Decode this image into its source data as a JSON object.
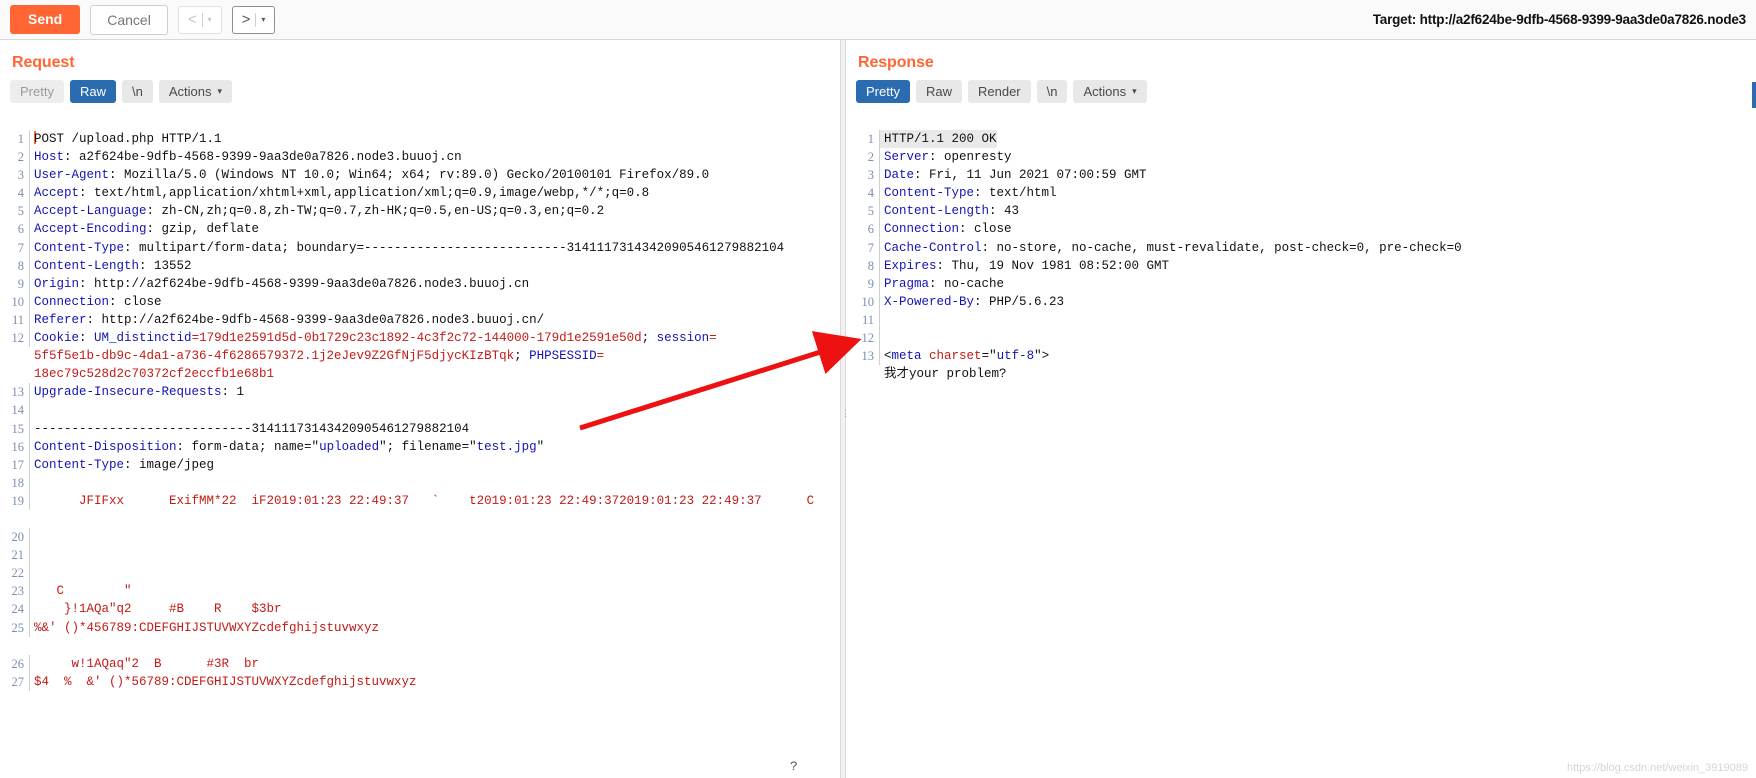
{
  "toolbar": {
    "send_label": "Send",
    "cancel_label": "Cancel",
    "prev_arrow": "<",
    "next_arrow": ">",
    "caret": "▾",
    "target_label": "Target: http://a2f624be-9dfb-4568-9399-9aa3de0a7826.node3"
  },
  "request": {
    "title": "Request",
    "tabs": [
      {
        "label": "Pretty",
        "selected": false,
        "muted": true
      },
      {
        "label": "Raw",
        "selected": true,
        "muted": false
      },
      {
        "label": "\\n",
        "selected": false,
        "muted": false
      }
    ],
    "actions_label": "Actions",
    "actions_caret": "⌄",
    "lines": [
      {
        "n": "1",
        "segments": [
          {
            "t": "POST /upload.php HTTP/1.1",
            "c": "v"
          }
        ],
        "caret": true
      },
      {
        "n": "2",
        "segments": [
          {
            "t": "Host",
            "c": "k"
          },
          {
            "t": ": a2f624be-9dfb-4568-9399-9aa3de0a7826.node3.buuoj.cn",
            "c": "v"
          }
        ]
      },
      {
        "n": "3",
        "segments": [
          {
            "t": "User-Agent",
            "c": "k"
          },
          {
            "t": ": Mozilla/5.0 (Windows NT 10.0; Win64; x64; rv:89.0) Gecko/20100101 Firefox/89.0",
            "c": "v"
          }
        ]
      },
      {
        "n": "4",
        "segments": [
          {
            "t": "Accept",
            "c": "k"
          },
          {
            "t": ": text/html,application/xhtml+xml,application/xml;q=0.9,image/webp,*/*;q=0.8",
            "c": "v"
          }
        ]
      },
      {
        "n": "5",
        "segments": [
          {
            "t": "Accept-Language",
            "c": "k"
          },
          {
            "t": ": zh-CN,zh;q=0.8,zh-TW;q=0.7,zh-HK;q=0.5,en-US;q=0.3,en;q=0.2",
            "c": "v"
          }
        ]
      },
      {
        "n": "6",
        "segments": [
          {
            "t": "Accept-Encoding",
            "c": "k"
          },
          {
            "t": ": gzip, deflate",
            "c": "v"
          }
        ]
      },
      {
        "n": "7",
        "segments": [
          {
            "t": "Content-Type",
            "c": "k"
          },
          {
            "t": ": multipart/form-data; boundary=---------------------------31411173143420905461279882104",
            "c": "v"
          }
        ]
      },
      {
        "n": "8",
        "segments": [
          {
            "t": "Content-Length",
            "c": "k"
          },
          {
            "t": ": 13552",
            "c": "v"
          }
        ]
      },
      {
        "n": "9",
        "segments": [
          {
            "t": "Origin",
            "c": "k"
          },
          {
            "t": ": http://a2f624be-9dfb-4568-9399-9aa3de0a7826.node3.buuoj.cn",
            "c": "v"
          }
        ]
      },
      {
        "n": "10",
        "segments": [
          {
            "t": "Connection",
            "c": "k"
          },
          {
            "t": ": close",
            "c": "v"
          }
        ]
      },
      {
        "n": "11",
        "segments": [
          {
            "t": "Referer",
            "c": "k"
          },
          {
            "t": ": http://a2f624be-9dfb-4568-9399-9aa3de0a7826.node3.buuoj.cn/",
            "c": "v"
          }
        ]
      },
      {
        "n": "12",
        "segments": [
          {
            "t": "Cookie",
            "c": "k"
          },
          {
            "t": ": ",
            "c": "v"
          },
          {
            "t": "UM_distinctid",
            "c": "ck"
          },
          {
            "t": "=179d1e2591d5d-0b1729c23c1892-4c3f2c72-144000-179d1e2591e50d",
            "c": "cv"
          },
          {
            "t": "; ",
            "c": "v"
          },
          {
            "t": "session",
            "c": "ck"
          },
          {
            "t": "=",
            "c": "cv"
          }
        ]
      },
      {
        "n": "",
        "segments": [
          {
            "t": "5f5f5e1b-db9c-4da1-a736-4f6286579372.1j2eJev9Z2GfNjF5djycKIzBTqk",
            "c": "cv"
          },
          {
            "t": "; ",
            "c": "v"
          },
          {
            "t": "PHPSESSID",
            "c": "ck"
          },
          {
            "t": "=",
            "c": "cv"
          }
        ]
      },
      {
        "n": "",
        "segments": [
          {
            "t": "18ec79c528d2c70372cf2eccfb1e68b1",
            "c": "cv"
          }
        ]
      },
      {
        "n": "13",
        "segments": [
          {
            "t": "Upgrade-Insecure-Requests",
            "c": "k"
          },
          {
            "t": ": 1",
            "c": "v"
          }
        ]
      },
      {
        "n": "14",
        "segments": []
      },
      {
        "n": "15",
        "segments": [
          {
            "t": "-----------------------------31411173143420905461279882104",
            "c": "v"
          }
        ]
      },
      {
        "n": "16",
        "segments": [
          {
            "t": "Content-Disposition",
            "c": "k"
          },
          {
            "t": ": form-data; name=\"",
            "c": "v"
          },
          {
            "t": "uploaded",
            "c": "at"
          },
          {
            "t": "\"; filename=\"",
            "c": "v"
          },
          {
            "t": "test.jpg",
            "c": "at"
          },
          {
            "t": "\"",
            "c": "v"
          }
        ]
      },
      {
        "n": "17",
        "segments": [
          {
            "t": "Content-Type",
            "c": "k"
          },
          {
            "t": ": image/jpeg",
            "c": "v"
          }
        ]
      },
      {
        "n": "18",
        "segments": []
      },
      {
        "n": "19",
        "segments": [
          {
            "t": "      JFIFxx      ExifMM*22  iF2019:01:23 22:49:37   `    t2019:01:23 22:49:372019:01:23 22:49:37      C",
            "c": "bin"
          }
        ]
      },
      {
        "n": "",
        "segments": []
      },
      {
        "n": "20",
        "segments": []
      },
      {
        "n": "21",
        "segments": []
      },
      {
        "n": "22",
        "segments": []
      },
      {
        "n": "23",
        "segments": [
          {
            "t": "   C        ʺ",
            "c": "bin"
          }
        ]
      },
      {
        "n": "24",
        "segments": [
          {
            "t": "    }!1AQaʺq2     #B    R    $3br",
            "c": "bin"
          }
        ]
      },
      {
        "n": "25",
        "segments": [
          {
            "t": "%&' ()*456789:CDEFGHIJSTUVWXYZcdefghijstuvwxyz",
            "c": "bin"
          }
        ]
      },
      {
        "n": "",
        "segments": []
      },
      {
        "n": "26",
        "segments": [
          {
            "t": "     w!1AQaqʺ2  B      #3R  br",
            "c": "bin"
          }
        ]
      },
      {
        "n": "27",
        "segments": [
          {
            "t": "$4  %  &' ()*56789:CDEFGHIJSTUVWXYZcdefghijstuvwxyz",
            "c": "bin"
          }
        ]
      }
    ],
    "bottom_marker": "?"
  },
  "response": {
    "title": "Response",
    "tabs": [
      {
        "label": "Pretty",
        "selected": true,
        "muted": false
      },
      {
        "label": "Raw",
        "selected": false,
        "muted": false
      },
      {
        "label": "Render",
        "selected": false,
        "muted": false
      },
      {
        "label": "\\n",
        "selected": false,
        "muted": false
      }
    ],
    "actions_label": "Actions",
    "actions_caret": "⌄",
    "lines": [
      {
        "n": "1",
        "hl": true,
        "segments": [
          {
            "t": "HTTP/1.1 200 OK",
            "c": "v"
          }
        ]
      },
      {
        "n": "2",
        "segments": [
          {
            "t": "Server",
            "c": "k"
          },
          {
            "t": ": openresty",
            "c": "v"
          }
        ]
      },
      {
        "n": "3",
        "segments": [
          {
            "t": "Date",
            "c": "k"
          },
          {
            "t": ": Fri, 11 Jun 2021 07:00:59 GMT",
            "c": "v"
          }
        ]
      },
      {
        "n": "4",
        "segments": [
          {
            "t": "Content-Type",
            "c": "k"
          },
          {
            "t": ": text/html",
            "c": "v"
          }
        ]
      },
      {
        "n": "5",
        "segments": [
          {
            "t": "Content-Length",
            "c": "k"
          },
          {
            "t": ": 43",
            "c": "v"
          }
        ]
      },
      {
        "n": "6",
        "segments": [
          {
            "t": "Connection",
            "c": "k"
          },
          {
            "t": ": close",
            "c": "v"
          }
        ]
      },
      {
        "n": "7",
        "segments": [
          {
            "t": "Cache-Control",
            "c": "k"
          },
          {
            "t": ": no-store, no-cache, must-revalidate, post-check=0, pre-check=0",
            "c": "v"
          }
        ]
      },
      {
        "n": "8",
        "segments": [
          {
            "t": "Expires",
            "c": "k"
          },
          {
            "t": ": Thu, 19 Nov 1981 08:52:00 GMT",
            "c": "v"
          }
        ]
      },
      {
        "n": "9",
        "segments": [
          {
            "t": "Pragma",
            "c": "k"
          },
          {
            "t": ": no-cache",
            "c": "v"
          }
        ]
      },
      {
        "n": "10",
        "segments": [
          {
            "t": "X-Powered-By",
            "c": "k"
          },
          {
            "t": ": PHP/5.6.23",
            "c": "v"
          }
        ]
      },
      {
        "n": "11",
        "segments": []
      },
      {
        "n": "12",
        "segments": []
      },
      {
        "n": "13",
        "segments": [
          {
            "t": "<",
            "c": "v"
          },
          {
            "t": "meta",
            "c": "tagname"
          },
          {
            "t": " ",
            "c": "v"
          },
          {
            "t": "charset",
            "c": "cv"
          },
          {
            "t": "=\"",
            "c": "v"
          },
          {
            "t": "utf-8",
            "c": "at"
          },
          {
            "t": "\">",
            "c": "v"
          }
        ]
      },
      {
        "n": "",
        "segments": [
          {
            "t": "我才",
            "c": "v"
          },
          {
            "t": "your problem?",
            "c": "v"
          }
        ]
      }
    ]
  },
  "annotation": {
    "arrow_color": "#ee1111"
  },
  "watermark": "https://blog.csdn.net/weixin_3919089"
}
